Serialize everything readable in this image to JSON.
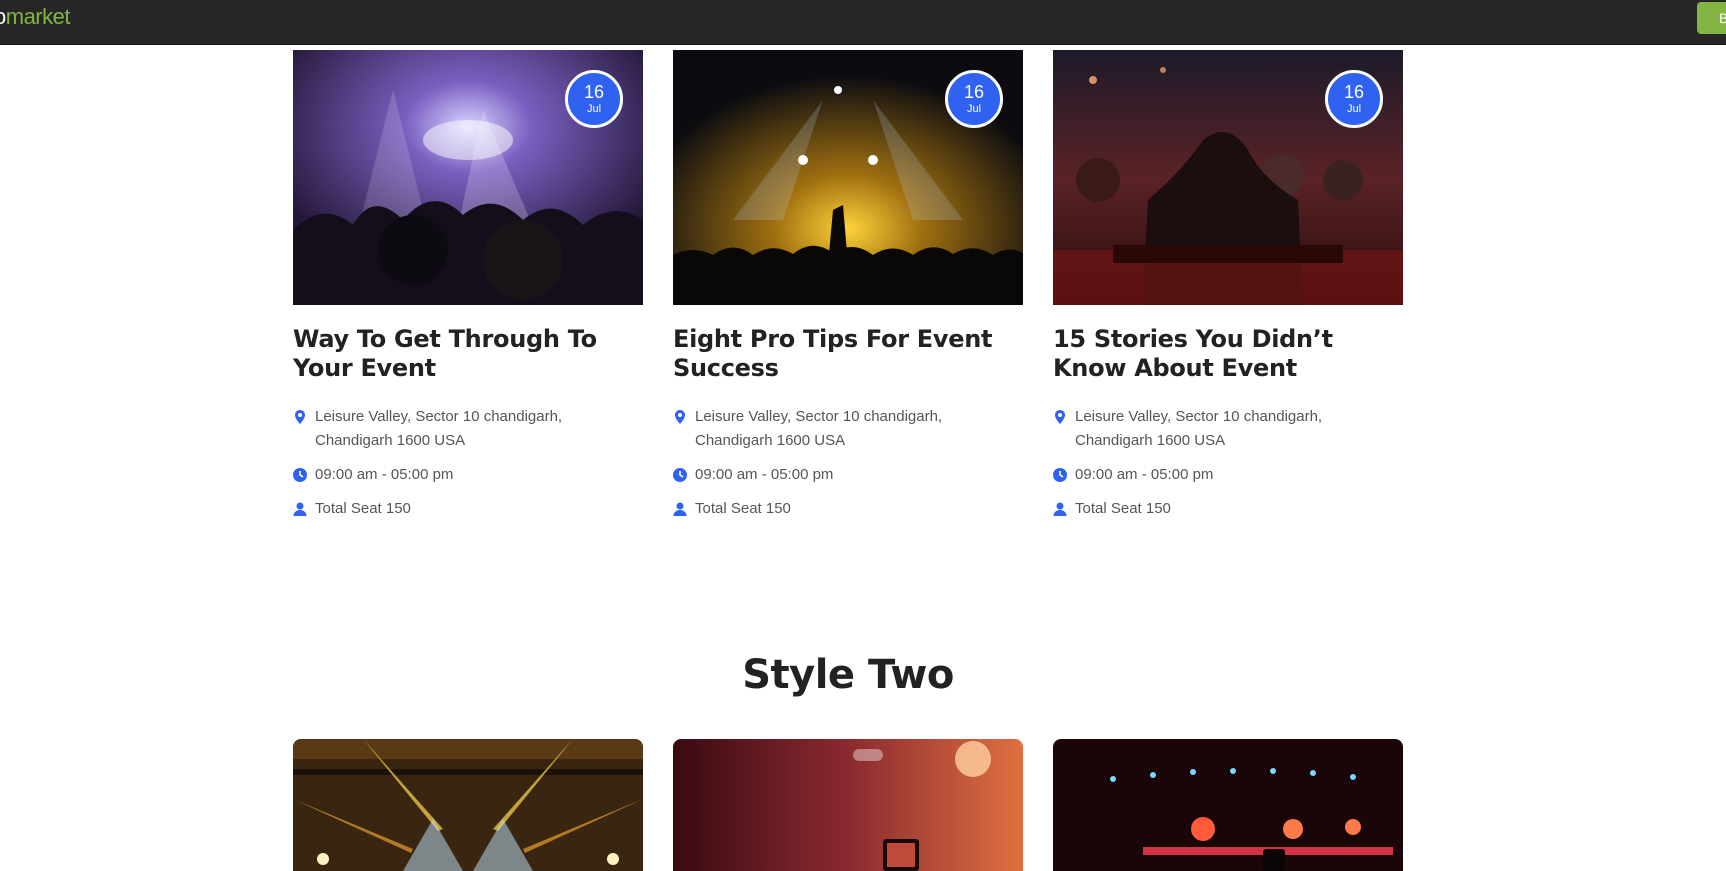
{
  "header": {
    "logo_prefix": "o",
    "logo_text": "market",
    "buy_label": "B"
  },
  "events": [
    {
      "day": "16",
      "month": "Jul",
      "title": "Way To Get Through To Your Event",
      "address": "Leisure Valley, Sector 10 chandigarh, Chandigarh 1600 USA",
      "time": "09:00 am - 05:00 pm",
      "seats": "Total Seat 150"
    },
    {
      "day": "16",
      "month": "Jul",
      "title": "Eight Pro Tips For Event Success",
      "address": "Leisure Valley, Sector 10 chandigarh, Chandigarh 1600 USA",
      "time": "09:00 am - 05:00 pm",
      "seats": "Total Seat 150"
    },
    {
      "day": "16",
      "month": "Jul",
      "title": "15 Stories You Didn’t Know About Event",
      "address": "Leisure Valley, Sector 10 chandigarh, Chandigarh 1600 USA",
      "time": "09:00 am - 05:00 pm",
      "seats": "Total Seat 150"
    }
  ],
  "section_two_title": "Style Two",
  "colors": {
    "accent": "#2f62f0",
    "brand_green": "#82b541",
    "topbar": "#262626"
  },
  "icons": [
    "map-pin-icon",
    "clock-icon",
    "user-icon"
  ]
}
